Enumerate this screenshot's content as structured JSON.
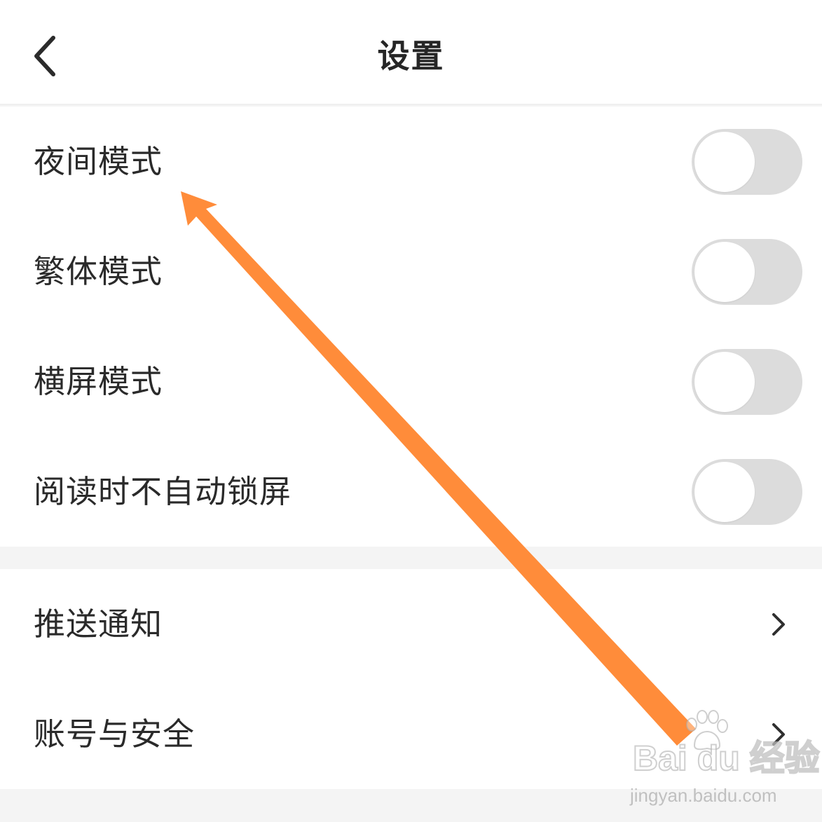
{
  "header": {
    "title": "设置",
    "back_icon": "chevron-left-icon"
  },
  "toggle_settings": [
    {
      "label": "夜间模式",
      "enabled": false
    },
    {
      "label": "繁体模式",
      "enabled": false
    },
    {
      "label": "横屏模式",
      "enabled": false
    },
    {
      "label": "阅读时不自动锁屏",
      "enabled": false
    }
  ],
  "nav_settings": [
    {
      "label": "推送通知",
      "icon": "chevron-right-icon"
    },
    {
      "label": "账号与安全",
      "icon": "chevron-right-icon"
    }
  ],
  "annotation": {
    "type": "arrow",
    "color": "#ff8c3a",
    "points_to": "夜间模式"
  },
  "watermark": {
    "brand": "Bai du 经验",
    "url": "jingyan.baidu.com"
  },
  "colors": {
    "toggle_off_track": "#dcdcdc",
    "toggle_knob": "#ffffff",
    "group_separator": "#f4f4f4",
    "text": "#2a2a2a"
  }
}
